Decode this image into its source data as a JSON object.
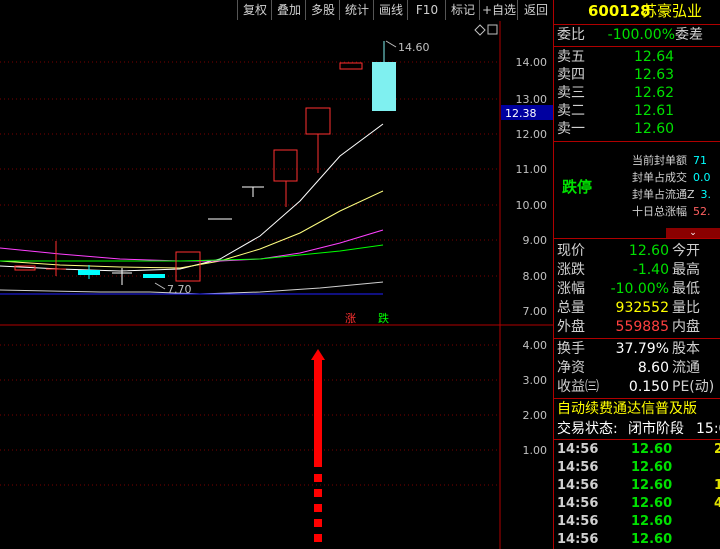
{
  "toolbar": {
    "items": [
      "复权",
      "叠加",
      "多股",
      "统计",
      "画线",
      "F10",
      "标记",
      "+自选",
      "返回"
    ]
  },
  "chart": {
    "price_axis": [
      "14.00",
      "13.00",
      "12.00",
      "11.00",
      "10.00",
      "9.00",
      "8.00",
      "7.00"
    ],
    "current_price_tag": "12.38",
    "high_label": "14.60",
    "low_label": "7.70",
    "zhang_label": "涨",
    "die_label": "跌",
    "volume_axis": [
      "4.00",
      "3.00",
      "2.00",
      "1.00"
    ],
    "colors": {
      "up": "#ff3030",
      "down": "#00ffff",
      "ma1": "#ffffff",
      "ma2": "#ffff80",
      "ma3": "#ff40ff",
      "ma4": "#00ff00",
      "base": "#0000ff"
    }
  },
  "quote": {
    "code": "600128",
    "name": "苏豪弘业",
    "weibi_label": "委比",
    "weibi_value": "-100.00%",
    "weicha_label": "委差",
    "asks": [
      {
        "label": "卖五",
        "price": "12.64"
      },
      {
        "label": "卖四",
        "price": "12.63"
      },
      {
        "label": "卖三",
        "price": "12.62"
      },
      {
        "label": "卖二",
        "price": "12.61"
      },
      {
        "label": "卖一",
        "price": "12.60"
      }
    ],
    "limit_status": "跌停",
    "limit_info": [
      {
        "label": "当前封单额",
        "value": "71"
      },
      {
        "label": "封单占成交",
        "value": "0.0"
      },
      {
        "label": "封单占流通Z",
        "value": "3."
      },
      {
        "label": "十日总涨幅",
        "value": "52."
      }
    ],
    "stats": [
      {
        "label": "现价",
        "value": "12.60",
        "label2": "今开"
      },
      {
        "label": "涨跌",
        "value": "-1.40",
        "label2": "最高"
      },
      {
        "label": "涨幅",
        "value": "-10.00%",
        "label2": "最低"
      },
      {
        "label": "总量",
        "value": "932552",
        "label2": "量比"
      },
      {
        "label": "外盘",
        "value": "559885",
        "label2": "内盘"
      }
    ],
    "stats2": [
      {
        "label": "换手",
        "value": "37.79%",
        "label2": "股本"
      },
      {
        "label": "净资",
        "value": "8.60",
        "label2": "流通"
      },
      {
        "label": "收益㈢",
        "value": "0.150",
        "label2": "PE(动)"
      }
    ],
    "promo": "自动续费通达信普及版",
    "status_label": "交易状态:",
    "status_value": "闭市阶段",
    "status_time": "15:0",
    "ticks": [
      {
        "time": "14:56",
        "price": "12.60",
        "vol": "2"
      },
      {
        "time": "14:56",
        "price": "12.60",
        "vol": ""
      },
      {
        "time": "14:56",
        "price": "12.60",
        "vol": "1"
      },
      {
        "time": "14:56",
        "price": "12.60",
        "vol": "4"
      },
      {
        "time": "14:56",
        "price": "12.60",
        "vol": ""
      },
      {
        "time": "14:56",
        "price": "12.60",
        "vol": ""
      }
    ]
  }
}
